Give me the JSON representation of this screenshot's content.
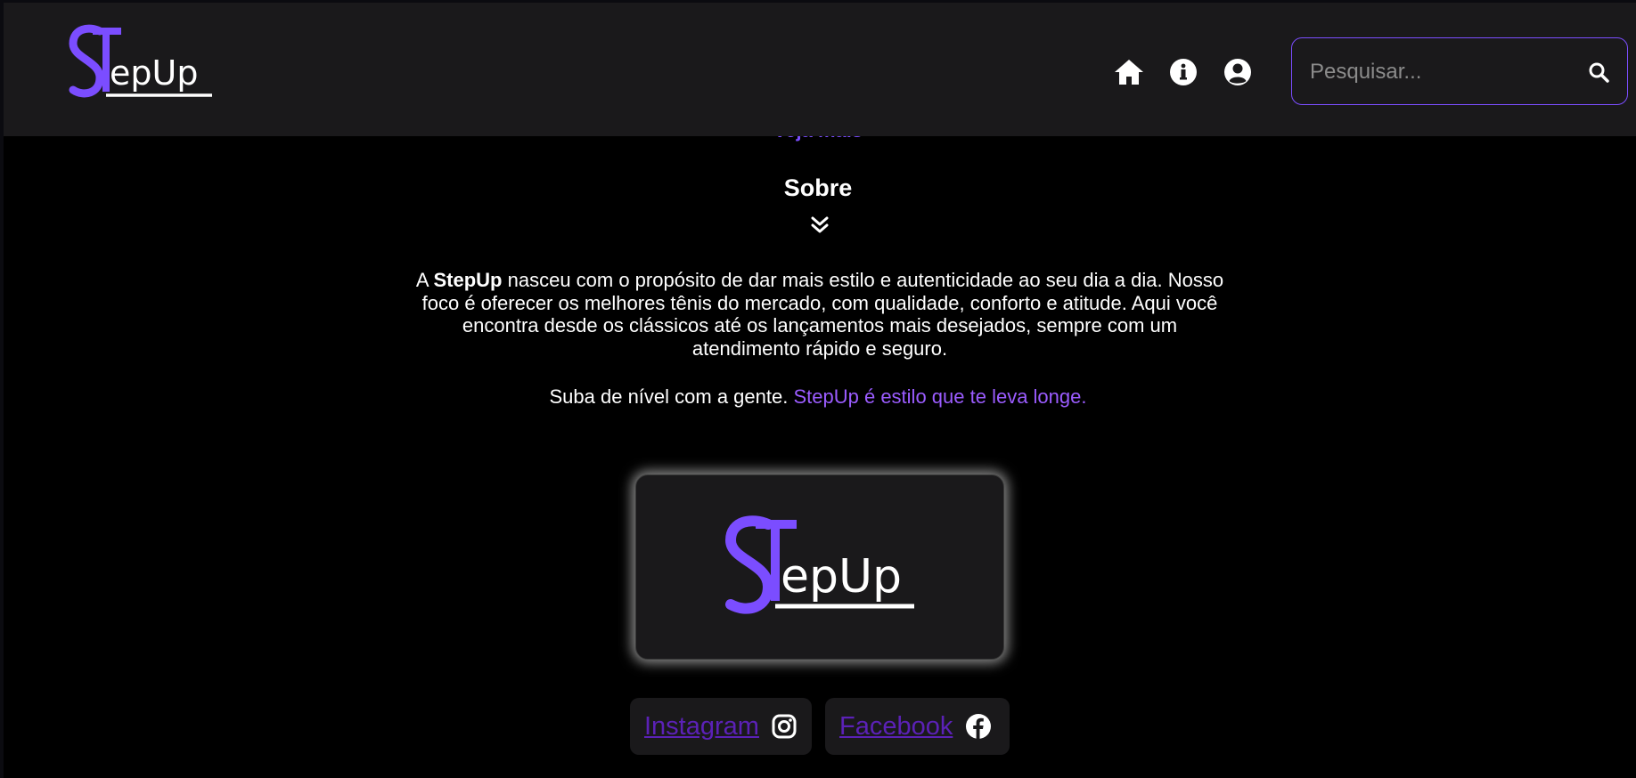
{
  "header": {
    "logo_text": "StepUp",
    "search": {
      "placeholder": "Pesquisar...",
      "value": ""
    },
    "nav_icons": [
      "home-icon",
      "info-icon",
      "user-icon"
    ]
  },
  "content": {
    "ver_mais_label": "Veja mais",
    "sobre": {
      "title": "Sobre",
      "paragraph_prefix": "A",
      "brand": "StepUp",
      "paragraph_rest": "nasceu com o propósito de dar mais estilo e autenticidade ao seu dia a dia. Nosso foco é oferecer os melhores tênis do mercado, com qualidade, conforto e atitude. Aqui você encontra desde os clássicos até os lançamentos mais desejados, sempre com um atendimento rápido e seguro.",
      "tagline_plain": "Suba de nível com a gente.",
      "tagline_accent": "StepUp é estilo que te leva longe."
    },
    "logo_card_text": "StepUp",
    "social": {
      "instagram_label": "Instagram",
      "facebook_label": "Facebook"
    }
  },
  "colors": {
    "background": "#000000",
    "header_bg": "#1a191b",
    "accent_purple": "#7b4dff",
    "tagline_accent": "#9b5cff",
    "link_purple": "#5b21b6"
  }
}
